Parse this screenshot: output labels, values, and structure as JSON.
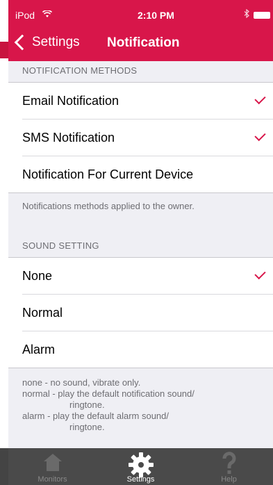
{
  "status": {
    "carrier": "iPod",
    "time": "2:10 PM"
  },
  "nav": {
    "back_label": "Settings",
    "title": "Notification"
  },
  "methods": {
    "header": "NOTIFICATION METHODS",
    "items": [
      {
        "label": "Email Notification",
        "checked": true
      },
      {
        "label": "SMS Notification",
        "checked": true
      },
      {
        "label": "Notification For Current Device",
        "checked": false
      }
    ],
    "footer": "Notifications methods applied to the owner."
  },
  "sound": {
    "header": "SOUND SETTING",
    "items": [
      {
        "label": "None",
        "checked": true
      },
      {
        "label": "Normal",
        "checked": false
      },
      {
        "label": "Alarm",
        "checked": false
      }
    ],
    "footer_lines": [
      "none - no sound, vibrate only.",
      "normal - play the default notification sound/",
      "ringtone.",
      "alarm - play the default alarm sound/",
      "ringtone."
    ]
  },
  "tabs": [
    {
      "label": "Monitors",
      "icon": "home-icon",
      "active": false
    },
    {
      "label": "Settings",
      "icon": "gear-icon",
      "active": true
    },
    {
      "label": "Help",
      "icon": "question-icon",
      "active": false
    }
  ],
  "colors": {
    "accent": "#d8164a",
    "tabbar": "#4a4a4a",
    "background": "#efeff4"
  }
}
